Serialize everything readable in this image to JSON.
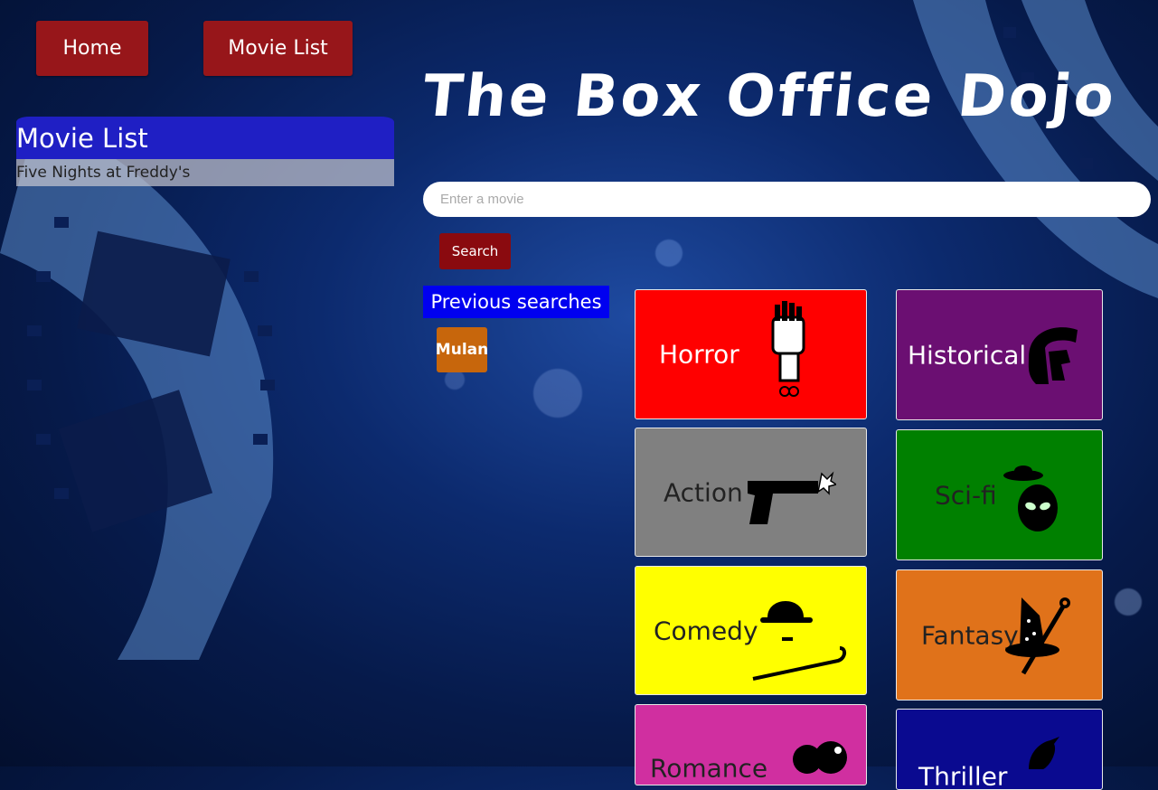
{
  "nav": {
    "home_label": "Home",
    "movie_list_label": "Movie List"
  },
  "sidebar": {
    "heading": "Movie List",
    "items": [
      "Five Nights at Freddy's"
    ]
  },
  "header": {
    "title": "The Box Office Dojo"
  },
  "search": {
    "placeholder": "Enter a movie",
    "value": "",
    "button_label": "Search"
  },
  "previous": {
    "heading": "Previous searches",
    "items": [
      "Mulan"
    ]
  },
  "genres": [
    {
      "label": "Horror",
      "color": "#ff0000",
      "icon": "zombie-hand-icon"
    },
    {
      "label": "Historical",
      "color": "#6b0f72",
      "icon": "spartan-helmet-icon"
    },
    {
      "label": "Action",
      "color": "#808080",
      "icon": "pistol-icon"
    },
    {
      "label": "Sci-fi",
      "color": "#008000",
      "icon": "alien-ufo-icon"
    },
    {
      "label": "Comedy",
      "color": "#ffff00",
      "icon": "bowler-hat-cane-icon"
    },
    {
      "label": "Fantasy",
      "color": "#e0721a",
      "icon": "wizard-hat-wand-icon"
    },
    {
      "label": "Romance",
      "color": "#d02fa0",
      "icon": "hearts-icon"
    },
    {
      "label": "Thriller",
      "color": "#0a0a90",
      "icon": "raven-icon"
    }
  ]
}
